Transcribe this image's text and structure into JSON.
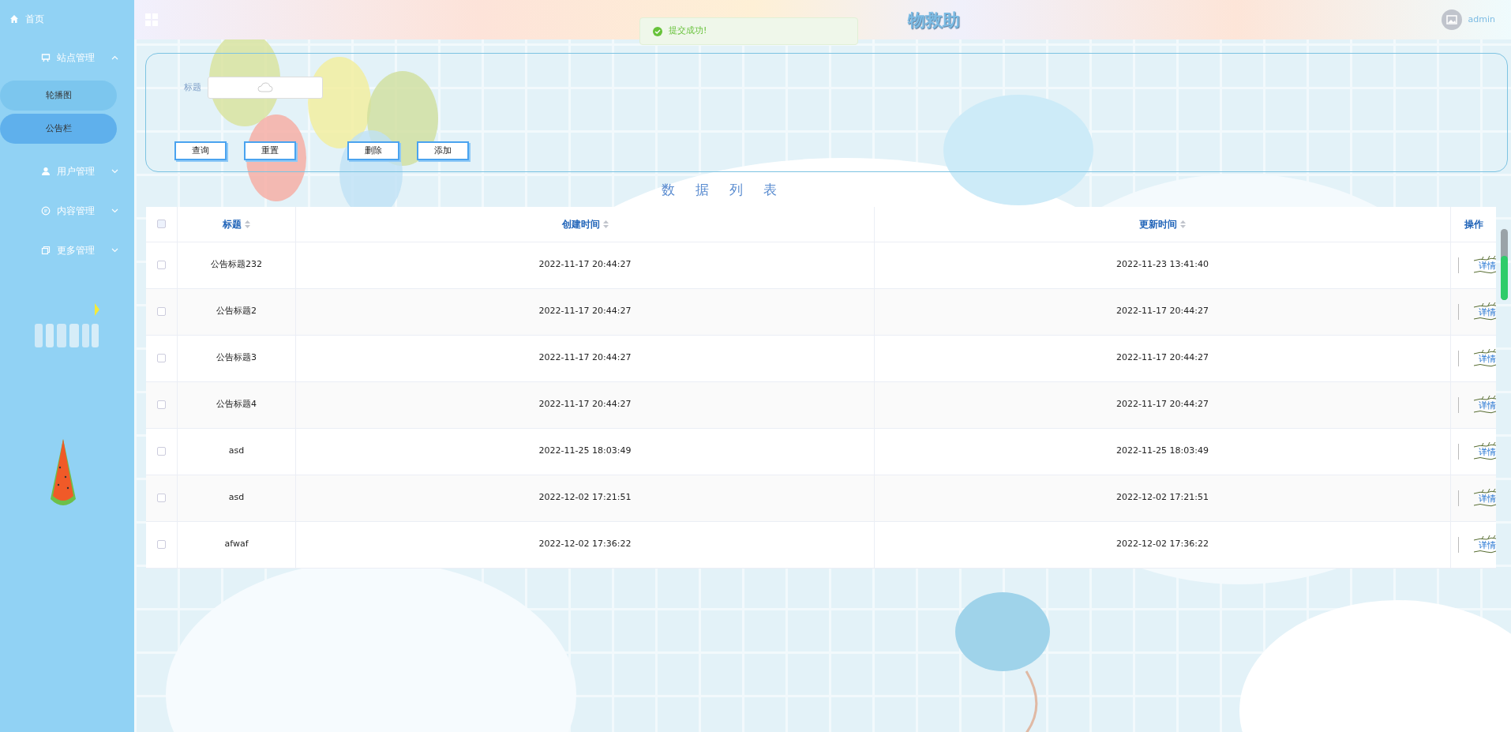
{
  "sidebar": {
    "items": [
      {
        "label": "首页",
        "kind": "link"
      },
      {
        "label": "站点管理",
        "kind": "group",
        "expanded": true,
        "children": [
          {
            "label": "轮播图",
            "selected": false
          },
          {
            "label": "公告栏",
            "selected": true
          }
        ]
      },
      {
        "label": "用户管理",
        "kind": "group",
        "expanded": false
      },
      {
        "label": "内容管理",
        "kind": "group",
        "expanded": false
      },
      {
        "label": "更多管理",
        "kind": "group",
        "expanded": false
      }
    ]
  },
  "header": {
    "title": "物救助",
    "user": "admin"
  },
  "toast": {
    "message": "提交成功!"
  },
  "search": {
    "label": "标题",
    "buttons": [
      "查询",
      "重置",
      "删除",
      "添加"
    ]
  },
  "section_title": "数据列表",
  "table": {
    "select_all": {
      "checked": false
    },
    "columns": [
      {
        "label": "标题",
        "sortable": true
      },
      {
        "label": "创建时间",
        "sortable": true
      },
      {
        "label": "更新时间",
        "sortable": true
      },
      {
        "label": "操作",
        "sortable": false
      }
    ],
    "rows": [
      {
        "checked": false,
        "title": "公告标题232",
        "created": "2022-11-17 20:44:27",
        "updated": "2022-11-23 13:41:40",
        "action": "详情"
      },
      {
        "checked": false,
        "title": "公告标题2",
        "created": "2022-11-17 20:44:27",
        "updated": "2022-11-17 20:44:27",
        "action": "详情"
      },
      {
        "checked": false,
        "title": "公告标题3",
        "created": "2022-11-17 20:44:27",
        "updated": "2022-11-17 20:44:27",
        "action": "详情"
      },
      {
        "checked": false,
        "title": "公告标题4",
        "created": "2022-11-17 20:44:27",
        "updated": "2022-11-17 20:44:27",
        "action": "详情"
      },
      {
        "checked": false,
        "title": "asd",
        "created": "2022-11-25 18:03:49",
        "updated": "2022-11-25 18:03:49",
        "action": "详情"
      },
      {
        "checked": false,
        "title": "asd",
        "created": "2022-12-02 17:21:51",
        "updated": "2022-12-02 17:21:51",
        "action": "详情"
      },
      {
        "checked": false,
        "title": "afwaf",
        "created": "2022-12-02 17:36:22",
        "updated": "2022-12-02 17:36:22",
        "action": "详情"
      }
    ]
  }
}
